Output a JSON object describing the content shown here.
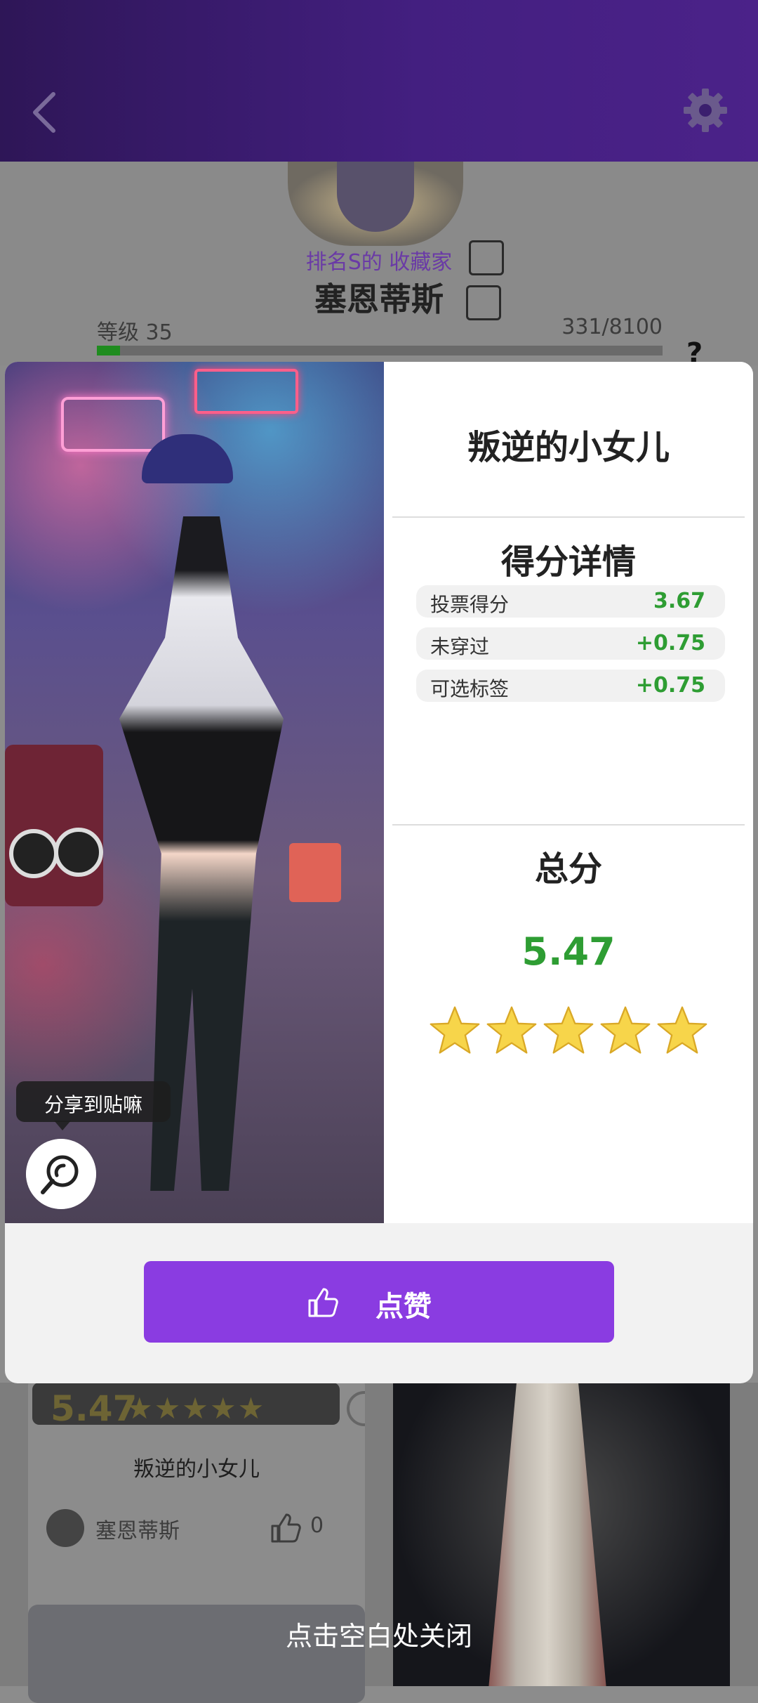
{
  "header": {
    "back_icon": "chevron-left-icon",
    "settings_icon": "gear-icon"
  },
  "profile": {
    "rank_text": "排名S的 收藏家",
    "player_name": "塞恩蒂斯",
    "level_label": "等级 35",
    "level": 35,
    "exp_text": "331/8100",
    "exp_current": 331,
    "exp_max": 8100,
    "help_label": "?"
  },
  "background_cards": [
    {
      "score": "5.47",
      "stars": "★★★★★",
      "title": "叛逆的小女儿",
      "author": "塞恩蒂斯",
      "likes": "0"
    }
  ],
  "modal": {
    "outfit_title": "叛逆的小女儿",
    "details_title": "得分详情",
    "score_rows": [
      {
        "label": "投票得分",
        "value": "3.67"
      },
      {
        "label": "未穿过",
        "value": "+0.75"
      },
      {
        "label": "可选标签",
        "value": "+0.75"
      }
    ],
    "total_title": "总分",
    "total_score": "5.47",
    "star_count": 5,
    "share_tip": "分享到贴嘛",
    "like_button": "点赞"
  },
  "close_hint": "点击空白处关闭",
  "colors": {
    "accent_purple": "#8a3ce1",
    "score_green": "#2e9d33",
    "header_purple": "#431f80"
  }
}
